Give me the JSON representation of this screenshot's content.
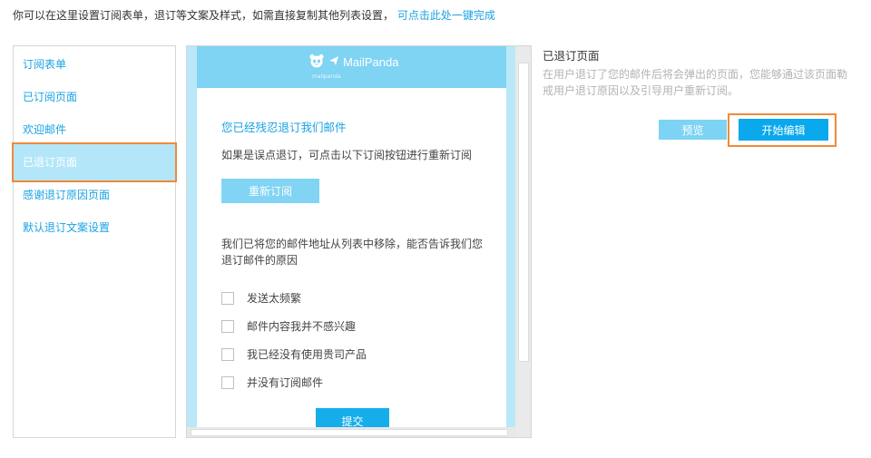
{
  "intro": {
    "text": "你可以在这里设置订阅表单，退订等文案及样式，如需直接复制其他列表设置，",
    "link": "可点击此处一键完成"
  },
  "sidebar": {
    "items": [
      {
        "label": "订阅表单"
      },
      {
        "label": "已订阅页面"
      },
      {
        "label": "欢迎邮件"
      },
      {
        "label": "已退订页面"
      },
      {
        "label": "感谢退订原因页面"
      },
      {
        "label": "默认退订文案设置"
      }
    ],
    "active_index": 3
  },
  "email_preview": {
    "logo_text": "MailPanda",
    "logo_sub": "mailpanda",
    "title": "您已经残忍退订我们邮件",
    "subtitle": "如果是误点退订，可点击以下订阅按钮进行重新订阅",
    "resubscribe_label": "重新订阅",
    "reason_prompt": "我们已将您的邮件地址从列表中移除，能否告诉我们您退订邮件的原因",
    "reasons": [
      "发送太频繁",
      "邮件内容我并不感兴趣",
      "我已经没有使用贵司产品",
      "并没有订阅邮件"
    ],
    "submit_label": "提交"
  },
  "info_panel": {
    "title": "已退订页面",
    "description": "在用户退订了您的邮件后将会弹出的页面，您能够通过该页面勒戒用户退订原因以及引导用户重新订阅。",
    "preview_label": "预览",
    "edit_label": "开始编辑"
  },
  "colors": {
    "accent": "#1ba2e4",
    "header_bg": "#7fd3f3",
    "highlight": "#f08a3a",
    "primary_button": "#0aa8ec"
  }
}
